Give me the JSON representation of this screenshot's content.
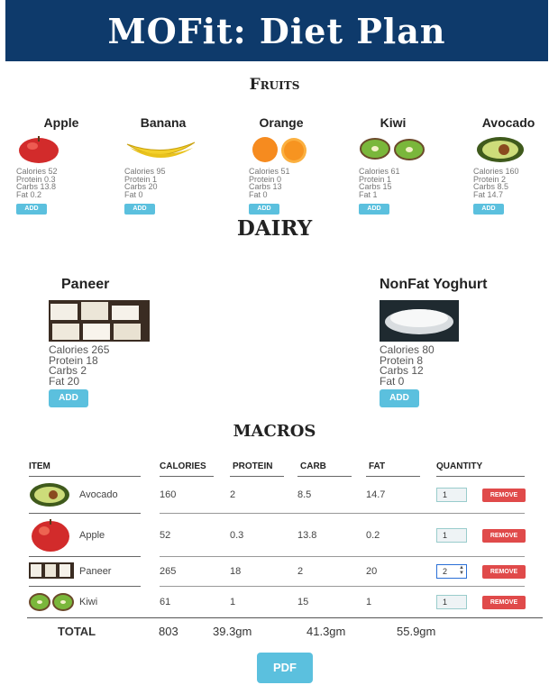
{
  "header": {
    "title": "MOFit: Diet Plan"
  },
  "sections": {
    "fruits": "Fruits",
    "dairy": "DAIRY",
    "macros": "MACROS"
  },
  "fruits": [
    {
      "name": "Apple",
      "calories": "Calories 52",
      "protein": "Protein 0.3",
      "carbs": "Carbs 13.8",
      "fat": "Fat 0.2",
      "add": "ADD"
    },
    {
      "name": "Banana",
      "calories": "Calories 95",
      "protein": "Protein 1",
      "carbs": "Carbs 20",
      "fat": "Fat 0",
      "add": "ADD"
    },
    {
      "name": "Orange",
      "calories": "Calories 51",
      "protein": "Protein 0",
      "carbs": "Carbs 13",
      "fat": "Fat 0",
      "add": "ADD"
    },
    {
      "name": "Kiwi",
      "calories": "Calories 61",
      "protein": "Protein 1",
      "carbs": "Carbs 15",
      "fat": "Fat 1",
      "add": "ADD"
    },
    {
      "name": "Avocado",
      "calories": "Calories 160",
      "protein": "Protein 2",
      "carbs": "Carbs 8.5",
      "fat": "Fat 14.7",
      "add": "ADD"
    }
  ],
  "dairy": [
    {
      "name": "Paneer",
      "calories": "Calories 265",
      "protein": "Protein 18",
      "carbs": "Carbs 2",
      "fat": "Fat 20",
      "add": "ADD"
    },
    {
      "name": "NonFat Yoghurt",
      "calories": "Calories 80",
      "protein": "Protein 8",
      "carbs": "Carbs 12",
      "fat": "Fat 0",
      "add": "ADD"
    }
  ],
  "table": {
    "headers": [
      "ITEM",
      "CALORIES",
      "PROTEIN",
      "CARB",
      "FAT",
      "QUANTITY"
    ],
    "rows": [
      {
        "item": "Avocado",
        "calories": "160",
        "protein": "2",
        "carb": "8.5",
        "fat": "14.7",
        "quantity": "1",
        "remove": "REMOVE"
      },
      {
        "item": "Apple",
        "calories": "52",
        "protein": "0.3",
        "carb": "13.8",
        "fat": "0.2",
        "quantity": "1",
        "remove": "REMOVE"
      },
      {
        "item": "Paneer",
        "calories": "265",
        "protein": "18",
        "carb": "2",
        "fat": "20",
        "quantity": "2",
        "remove": "REMOVE"
      },
      {
        "item": "Kiwi",
        "calories": "61",
        "protein": "1",
        "carb": "15",
        "fat": "1",
        "quantity": "1",
        "remove": "REMOVE"
      }
    ],
    "total": {
      "label": "TOTAL",
      "calories": "803",
      "protein": "39.3gm",
      "carb": "41.3gm",
      "fat": "55.9gm"
    }
  },
  "pdf_button": "PDF",
  "colors": {
    "header_bg": "#0e3a6b",
    "add_button": "#5bc0de",
    "remove_button": "#e04a4a"
  }
}
